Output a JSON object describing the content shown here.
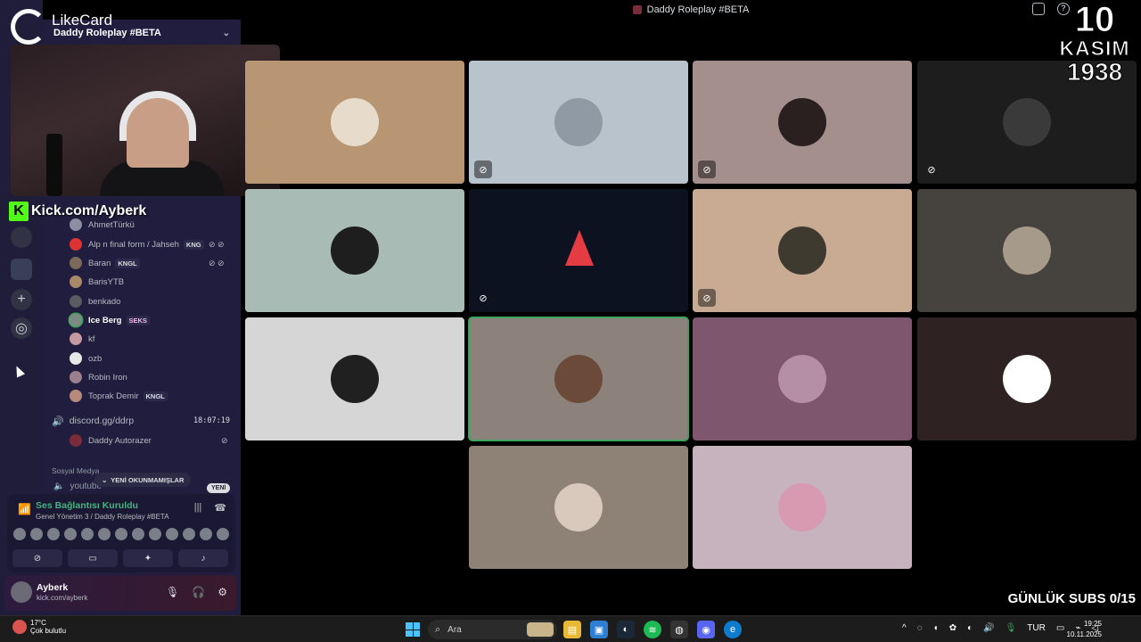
{
  "window": {
    "title": "Daddy Roleplay #BETA"
  },
  "overlay": {
    "brand": "LikeCard",
    "kick_url": "Kick.com/Ayberk",
    "kasim_number": "10",
    "kasim_text": "KASIM",
    "kasim_year": "1938",
    "subs": "GÜNLÜK SUBS 0/15"
  },
  "sidebar": {
    "server_name": "Daddy Roleplay #BETA",
    "members": [
      {
        "name": "AhmetTürkü",
        "tag": ""
      },
      {
        "name": "Alp n final form / Jahseh",
        "tag": "KNG"
      },
      {
        "name": "Baran",
        "tag": "KNGL"
      },
      {
        "name": "BarisYTB",
        "tag": ""
      },
      {
        "name": "benkado",
        "tag": ""
      },
      {
        "name": "Ice Berg",
        "tag": "SEKS"
      },
      {
        "name": "kf",
        "tag": ""
      },
      {
        "name": "ozb",
        "tag": ""
      },
      {
        "name": "Robin Iron",
        "tag": ""
      },
      {
        "name": "Toprak Demir",
        "tag": "KNGL"
      }
    ],
    "voice_channel": {
      "name": "discord.gg/ddrp",
      "time": "18:07:19"
    },
    "autorazer": "Daddy Autorazer",
    "category": "Sosyal Medya",
    "youtube_channel": "youtube",
    "unread_pill": "YENİ OKUNMAMIŞLAR",
    "new_badge": "YENİ"
  },
  "voice_panel": {
    "status": "Ses Bağlantısı Kuruldu",
    "channel_path": "Genel Yönetim 3 / Daddy Roleplay #BETA"
  },
  "user_panel": {
    "name": "Ayberk",
    "status": "kick.com/ayberk"
  },
  "taskbar": {
    "temp": "17°C",
    "weather": "Çok bulutlu",
    "search_placeholder": "Ara",
    "lang": "TUR",
    "time": "19:25",
    "date": "10.11.2025"
  },
  "colors": {
    "sidebar_bg": "#201d3f",
    "connected_green": "#43b581",
    "speaking_outline": "#3ba55d",
    "kick_green": "#53fc18"
  }
}
